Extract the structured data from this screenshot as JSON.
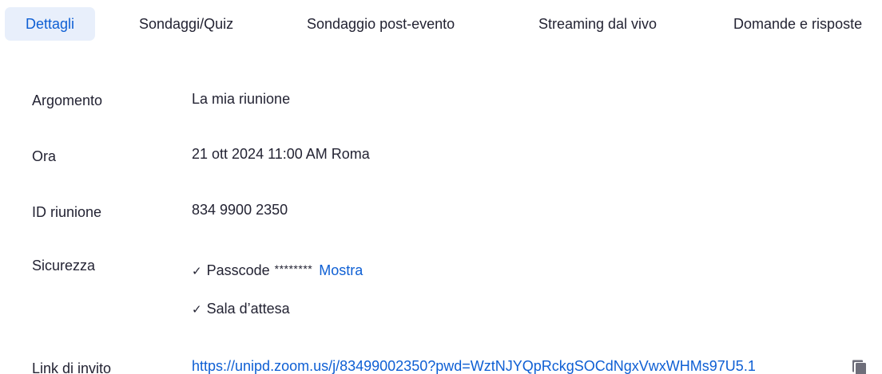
{
  "tabs": [
    {
      "label": "Dettagli",
      "active": true
    },
    {
      "label": "Sondaggi/Quiz",
      "active": false
    },
    {
      "label": "Sondaggio post-evento",
      "active": false
    },
    {
      "label": "Streaming dal vivo",
      "active": false
    },
    {
      "label": "Domande e risposte",
      "active": false
    }
  ],
  "details": {
    "topic_label": "Argomento",
    "topic_value": "La mia riunione",
    "time_label": "Ora",
    "time_value": "21 ott 2024 11:00 AM Roma",
    "meeting_id_label": "ID riunione",
    "meeting_id_value": "834 9900 2350",
    "security_label": "Sicurezza",
    "passcode_label": "Passcode",
    "passcode_masked": "********",
    "show_label": "Mostra",
    "waiting_room_label": "Sala d’attesa",
    "invite_label": "Link di invito",
    "invite_url": "https://unipd.zoom.us/j/83499002350?pwd=WztNJYQpRckgSOCdNgxVwxWHMs97U5.1"
  },
  "icons": {
    "check": "check-icon",
    "copy": "copy-icon"
  },
  "colors": {
    "accent": "#0e5fd4",
    "active_tab_bg": "#e8effb",
    "text": "#232333"
  }
}
